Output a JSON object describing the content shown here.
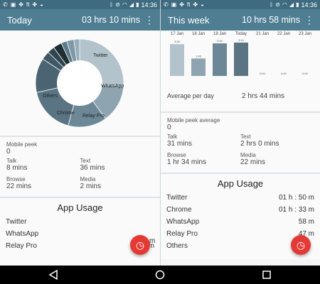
{
  "statusbar": {
    "time": "14:36",
    "left_icons": [
      "whatsapp-icon",
      "image-icon",
      "pinwheel-icon",
      "ft-icon",
      "pinwheel-icon",
      "android-icon"
    ],
    "right_icons": [
      "bluetooth-icon",
      "mute-icon",
      "wifi-icon",
      "signal-icon",
      "battery-icon"
    ],
    "ft_text": "ft"
  },
  "left": {
    "title": "Today",
    "total": "03 hrs 10 mins",
    "donut": {
      "labels": [
        "Twitter",
        "WhatsApp",
        "Relay Pro",
        "Chrome",
        "Others"
      ],
      "segments": [
        {
          "name": "Twitter",
          "value": 50,
          "color": "#b3c3cc"
        },
        {
          "name": "WhatsApp",
          "value": 26,
          "color": "#8ea5b1"
        },
        {
          "name": "Relay Pro",
          "value": 27,
          "color": "#6c8796"
        },
        {
          "name": "Chrome",
          "value": 33,
          "color": "#5a7483"
        },
        {
          "name": "Others",
          "value": 24,
          "color": "#4a6472"
        },
        {
          "name": "",
          "value": 6,
          "color": "#3f5866"
        },
        {
          "name": "",
          "value": 5,
          "color": "#2f4550"
        },
        {
          "name": "",
          "value": 6,
          "color": "#1f2f36"
        },
        {
          "name": "",
          "value": 4,
          "color": "#5f7b8a"
        },
        {
          "name": "",
          "value": 5,
          "color": "#7e98a6"
        },
        {
          "name": "",
          "value": 4,
          "color": "#98afbb"
        }
      ]
    },
    "stats": {
      "mobile_peek_label": "Mobile peek",
      "mobile_peek_value": "0",
      "talk_label": "Talk",
      "talk_value": "8 mins",
      "text_label": "Text",
      "text_value": "36 mins",
      "browse_label": "Browse",
      "browse_value": "22 mins",
      "media_label": "Media",
      "media_value": "2 mins"
    },
    "app_usage_title": "App Usage",
    "apps": [
      {
        "name": "Twitter",
        "time": ""
      },
      {
        "name": "WhatsApp",
        "time": ""
      },
      {
        "name": "Relay Pro",
        "time": "27 m"
      }
    ],
    "partial_m": "m"
  },
  "right": {
    "title": "This week",
    "total": "10 hrs 58 mins",
    "chart_data": {
      "type": "bar",
      "categories": [
        "17 Jan",
        "18 Jan",
        "19 Jan",
        "Today",
        "21 Jan",
        "22 Jan",
        "23 Jan"
      ],
      "values": [
        4.0,
        2.2,
        4.1,
        4.2,
        0,
        0,
        0
      ],
      "value_labels": [
        "3:26",
        "1:46",
        "3:33",
        "3:10",
        "0:00",
        "0:00",
        "0:00"
      ],
      "title": "",
      "xlabel": "",
      "ylabel": "",
      "ylim": [
        0,
        5
      ],
      "grid": false,
      "colors": [
        "#b3c3cc",
        "#8ea5b1",
        "#6c8796",
        "#5a7483"
      ]
    },
    "avg_label": "Average per day",
    "avg_value": "2 hrs 44 mins",
    "stats": {
      "mobile_peek_label": "Mobile peek average",
      "mobile_peek_value": "0",
      "talk_label": "Talk",
      "talk_value": "31 mins",
      "text_label": "Text",
      "text_value": "2 hrs 0 mins",
      "browse_label": "Browse",
      "browse_value": "1 hr 34 mins",
      "media_label": "Media",
      "media_value": "22 mins"
    },
    "app_usage_title": "App Usage",
    "apps": [
      {
        "name": "Twitter",
        "time": "01 h : 50 m"
      },
      {
        "name": "Chrome",
        "time": "01 h : 33 m"
      },
      {
        "name": "WhatsApp",
        "time": "58 m"
      },
      {
        "name": "Relay Pro",
        "time": "47 m"
      },
      {
        "name": "Others",
        "time": ""
      }
    ]
  },
  "navbar": {
    "icons": [
      "back-icon",
      "home-icon",
      "recents-icon"
    ]
  }
}
